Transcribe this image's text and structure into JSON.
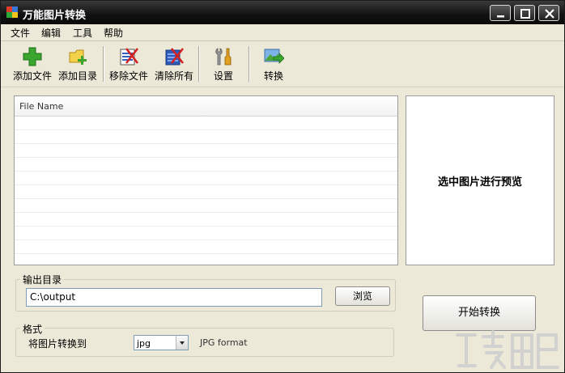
{
  "window": {
    "title": "万能图片转换"
  },
  "menu": [
    {
      "label": "文件"
    },
    {
      "label": "编辑"
    },
    {
      "label": "工具"
    },
    {
      "label": "帮助"
    }
  ],
  "toolbar": {
    "add_file": "添加文件",
    "add_folder": "添加目录",
    "remove_file": "移除文件",
    "clear_all": "清除所有",
    "settings": "设置",
    "convert": "转换"
  },
  "file_list": {
    "column_header": "File Name"
  },
  "preview": {
    "text": "选中图片进行预览"
  },
  "output": {
    "group_title": "输出目录",
    "path_value": "C:\\output",
    "browse_label": "浏览"
  },
  "format": {
    "group_title": "格式",
    "convert_to_label": "将图片转换到",
    "selected": "jpg",
    "description": "JPG format"
  },
  "start_button": "开始转换",
  "colors": {
    "titlebar": "#111111",
    "window_bg": "#ece9d8",
    "add_green": "#3aa62d",
    "remove_red": "#d42020"
  }
}
